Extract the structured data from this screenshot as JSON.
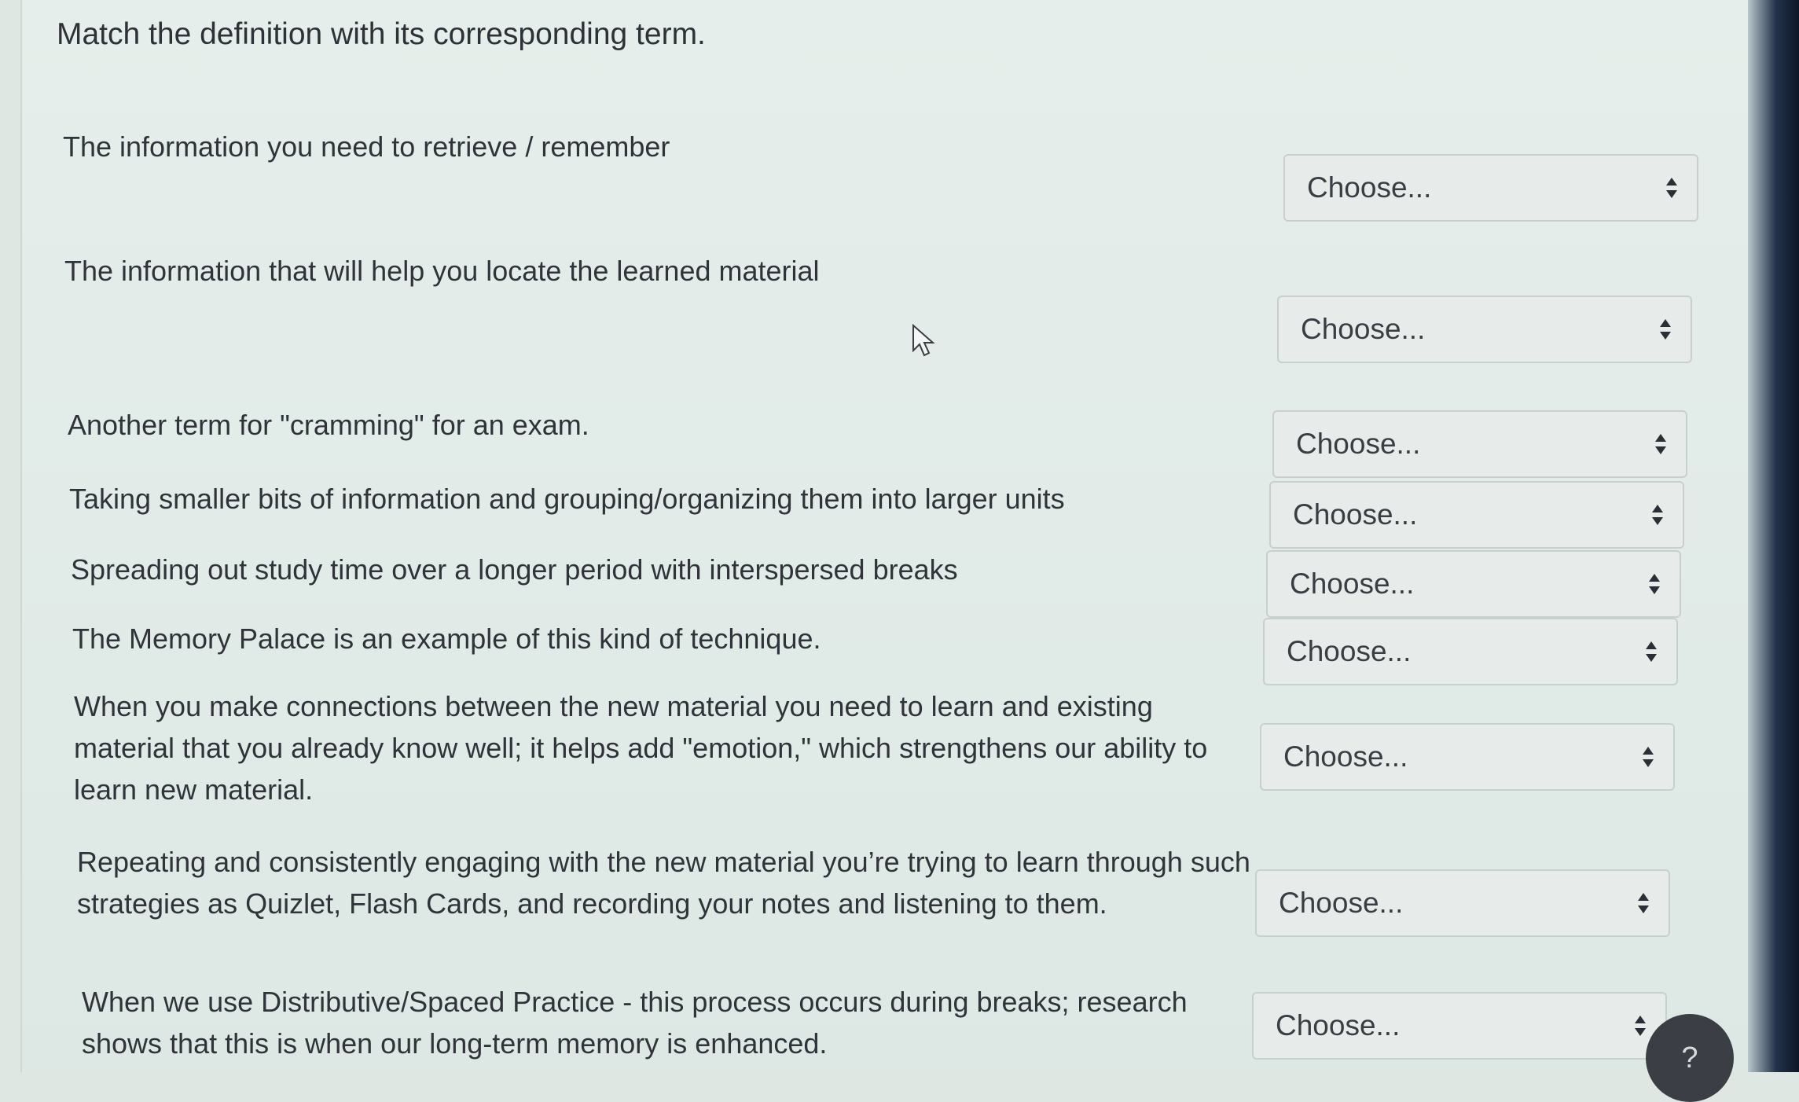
{
  "instruction": "Match the definition with its corresponding term.",
  "questions": [
    {
      "definition": "The information you need to retrieve / remember",
      "selected": "Choose..."
    },
    {
      "definition": "The information that will help you locate the learned material",
      "selected": "Choose..."
    },
    {
      "definition": "Another term for \"cramming\" for an exam.",
      "selected": "Choose..."
    },
    {
      "definition": "Taking smaller bits of information and grouping/organizing them into larger units",
      "selected": "Choose..."
    },
    {
      "definition": "Spreading out study time over a longer period with interspersed breaks",
      "selected": "Choose..."
    },
    {
      "definition": "The Memory Palace is an example of this kind of technique.",
      "selected": "Choose..."
    },
    {
      "definition": "When you make connections between the new material you need to learn and existing material that you already know well; it helps add \"emotion,\" which strengthens our ability to learn new material.",
      "selected": "Choose..."
    },
    {
      "definition": "Repeating and consistently engaging with the new material you’re trying to learn through such strategies as Quizlet, Flash Cards, and recording your notes and listening to them.",
      "selected": "Choose..."
    },
    {
      "definition": "When we use Distributive/Spaced Practice - this process occurs during breaks; research shows that this is when our long-term memory is enhanced.",
      "selected": "Choose..."
    }
  ],
  "help_label": "?",
  "icons": {
    "select_arrow": "sort-arrows-icon",
    "cursor": "mouse-pointer-icon",
    "help": "help-icon"
  }
}
